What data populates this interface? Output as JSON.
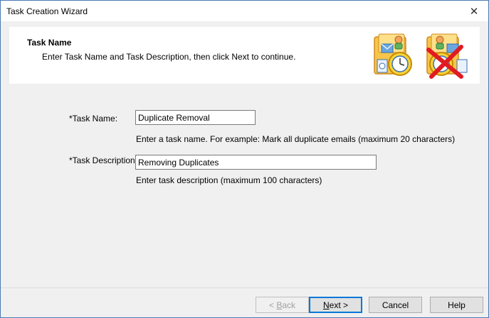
{
  "window": {
    "title": "Task Creation Wizard",
    "close_glyph": "✕"
  },
  "header": {
    "title": "Task Name",
    "subtitle": "Enter Task Name and Task Description, then click Next to continue.",
    "icons": [
      "mail-task-icon",
      "delete-task-icon"
    ]
  },
  "form": {
    "task_name": {
      "label": "*Task Name:",
      "value": "Duplicate Removal",
      "hint": "Enter a task name. For example: Mark all duplicate emails (maximum 20 characters)"
    },
    "task_description": {
      "label": "*Task Description:",
      "value": "Removing Duplicates",
      "hint": "Enter task description (maximum 100 characters)"
    }
  },
  "buttons": {
    "back_prefix": "< ",
    "back_key": "B",
    "back_rest": "ack",
    "next_key": "N",
    "next_rest": "ext >",
    "cancel": "Cancel",
    "help": "Help"
  },
  "colors": {
    "accent": "#0078d7",
    "window_border": "#4a7ab5",
    "panel_bg": "#ffffff",
    "dialog_bg": "#f0f0f0"
  }
}
